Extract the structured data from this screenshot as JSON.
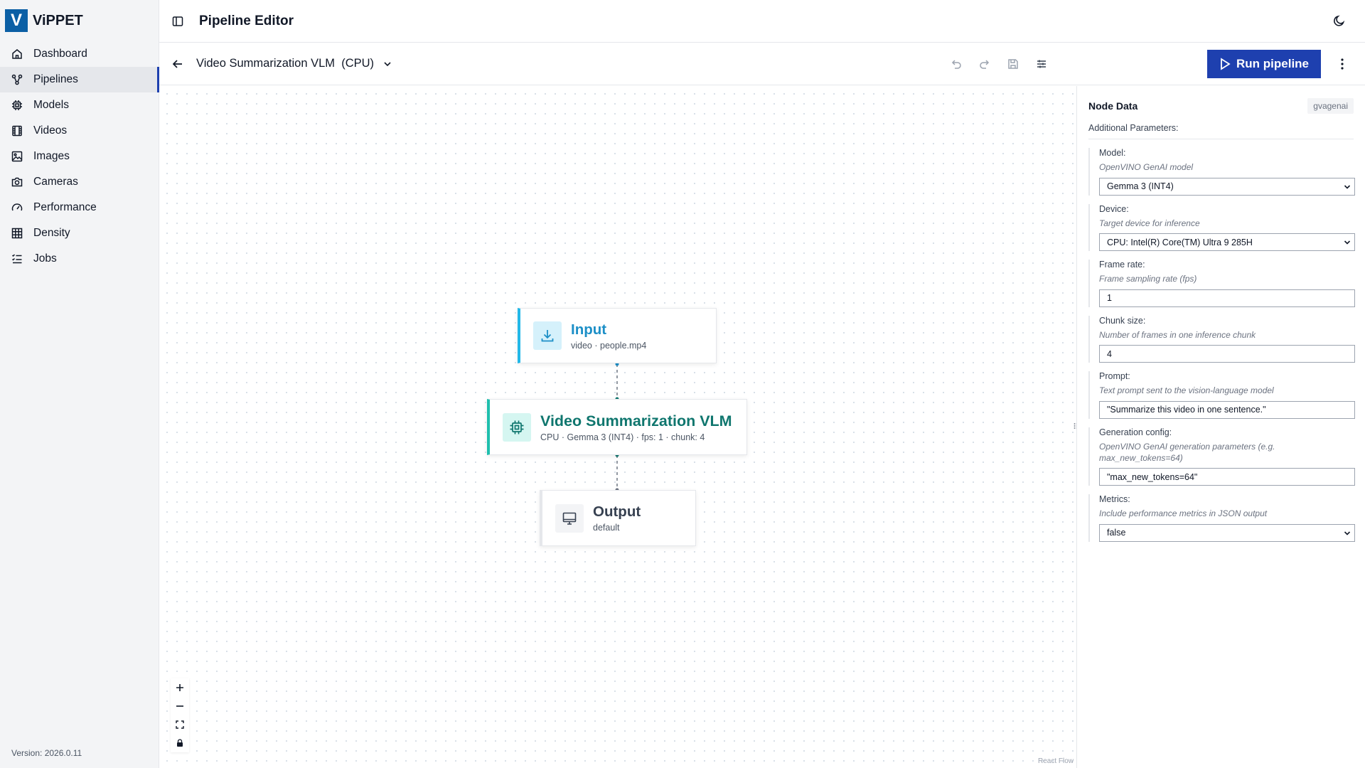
{
  "app": {
    "name": "ViPPET",
    "logo_letter": "V",
    "version": "Version: 2026.0.11"
  },
  "sidebar": {
    "items": [
      {
        "label": "Dashboard",
        "icon": "home-icon"
      },
      {
        "label": "Pipelines",
        "icon": "pipeline-icon",
        "active": true
      },
      {
        "label": "Models",
        "icon": "chip-icon"
      },
      {
        "label": "Videos",
        "icon": "film-icon"
      },
      {
        "label": "Images",
        "icon": "image-icon"
      },
      {
        "label": "Cameras",
        "icon": "camera-icon"
      },
      {
        "label": "Performance",
        "icon": "gauge-icon"
      },
      {
        "label": "Density",
        "icon": "grid-icon"
      },
      {
        "label": "Jobs",
        "icon": "list-icon"
      }
    ]
  },
  "header": {
    "title": "Pipeline Editor"
  },
  "toolbar": {
    "pipeline_name": "Video Summarization VLM  (CPU)",
    "run_label": "Run pipeline"
  },
  "canvas": {
    "nodes": {
      "input": {
        "title": "Input",
        "subtitle": "video · people.mp4"
      },
      "vlm": {
        "title": "Video Summarization VLM",
        "subtitle": "CPU · Gemma 3 (INT4) · fps: 1 · chunk: 4"
      },
      "output": {
        "title": "Output",
        "subtitle": "default"
      }
    },
    "attribution": "React Flow"
  },
  "panel": {
    "title": "Node Data",
    "badge": "gvagenai",
    "subtitle": "Additional Parameters:",
    "params": {
      "model": {
        "label": "Model:",
        "desc": "OpenVINO GenAI model",
        "value": "Gemma 3 (INT4)"
      },
      "device": {
        "label": "Device:",
        "desc": "Target device for inference",
        "value": "CPU: Intel(R) Core(TM) Ultra 9 285H"
      },
      "frame_rate": {
        "label": "Frame rate:",
        "desc": "Frame sampling rate (fps)",
        "value": "1"
      },
      "chunk_size": {
        "label": "Chunk size:",
        "desc": "Number of frames in one inference chunk",
        "value": "4"
      },
      "prompt": {
        "label": "Prompt:",
        "desc": "Text prompt sent to the vision-language model",
        "value": "\"Summarize this video in one sentence.\""
      },
      "generation_config": {
        "label": "Generation config:",
        "desc": "OpenVINO GenAI generation parameters (e.g. max_new_tokens=64)",
        "value": "\"max_new_tokens=64\""
      },
      "metrics": {
        "label": "Metrics:",
        "desc": "Include performance metrics in JSON output",
        "value": "false"
      }
    }
  },
  "colors": {
    "brand": "#0b5fa5",
    "run_button": "#1e40af",
    "input_accent": "#22b8e8",
    "vlm_accent": "#1fbfad"
  }
}
